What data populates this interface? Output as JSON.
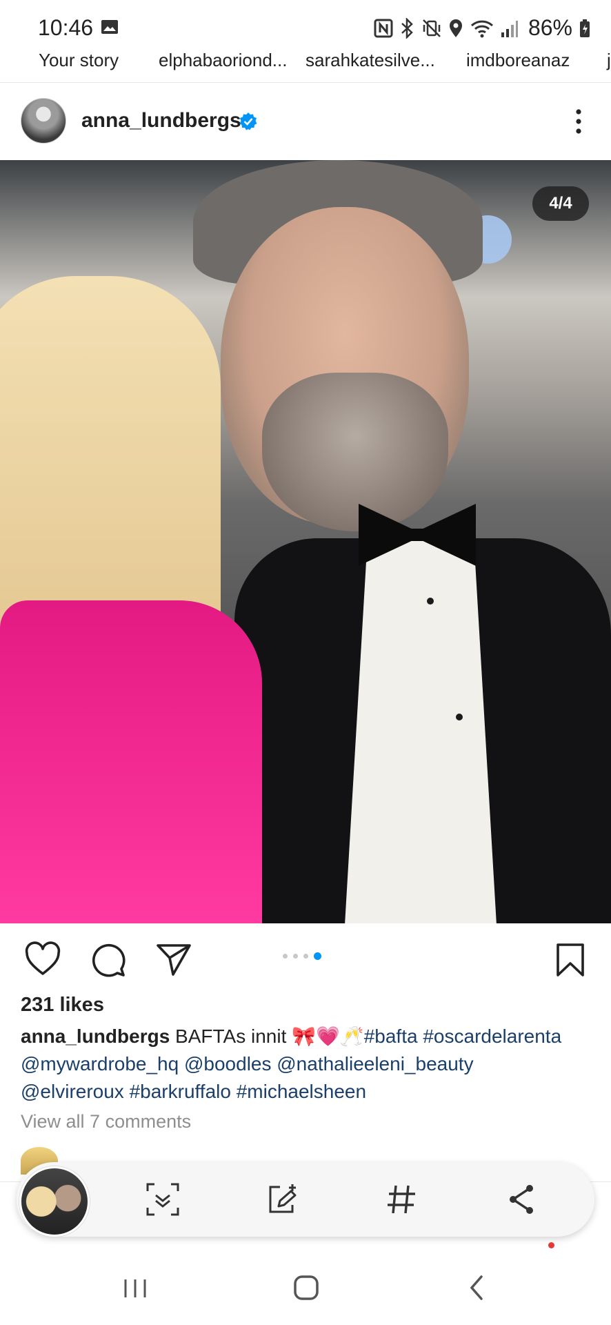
{
  "status_bar": {
    "time": "10:46",
    "battery": "86%",
    "icons": [
      "gallery-icon",
      "nfc-icon",
      "bluetooth-icon",
      "vibrate-mute-icon",
      "location-icon",
      "wifi-icon",
      "signal-icon",
      "battery-icon"
    ]
  },
  "stories": [
    {
      "label": "Your story"
    },
    {
      "label": "elphabaoriond..."
    },
    {
      "label": "sarahkatesilve..."
    },
    {
      "label": "imdboreanaz"
    },
    {
      "label": "j"
    }
  ],
  "post": {
    "username": "anna_lundbergs",
    "verified": true,
    "carousel_counter": "4/4",
    "carousel_total": 4,
    "carousel_active_index": 3,
    "likes": "231 likes",
    "caption_user": "anna_lundbergs",
    "caption_text": " BAFTAs innit 🎀💗🥂",
    "caption_tags_line1": "#bafta #oscardelarenta",
    "caption_line2": "@mywardrobe_hq @boodles @nathalieeleni_beauty",
    "caption_line3": "@elvireroux #barkruffalo #michaelsheen",
    "view_comments": "View all 7 comments"
  },
  "colors": {
    "accent_blue": "#0095f6",
    "link": "#1b3f6b"
  },
  "toolbar": {
    "icons": [
      "scan-icon",
      "edit-icon",
      "hashtag-icon",
      "share-icon"
    ]
  },
  "nav": {
    "icons": [
      "recents-icon",
      "home-icon",
      "back-icon"
    ]
  }
}
